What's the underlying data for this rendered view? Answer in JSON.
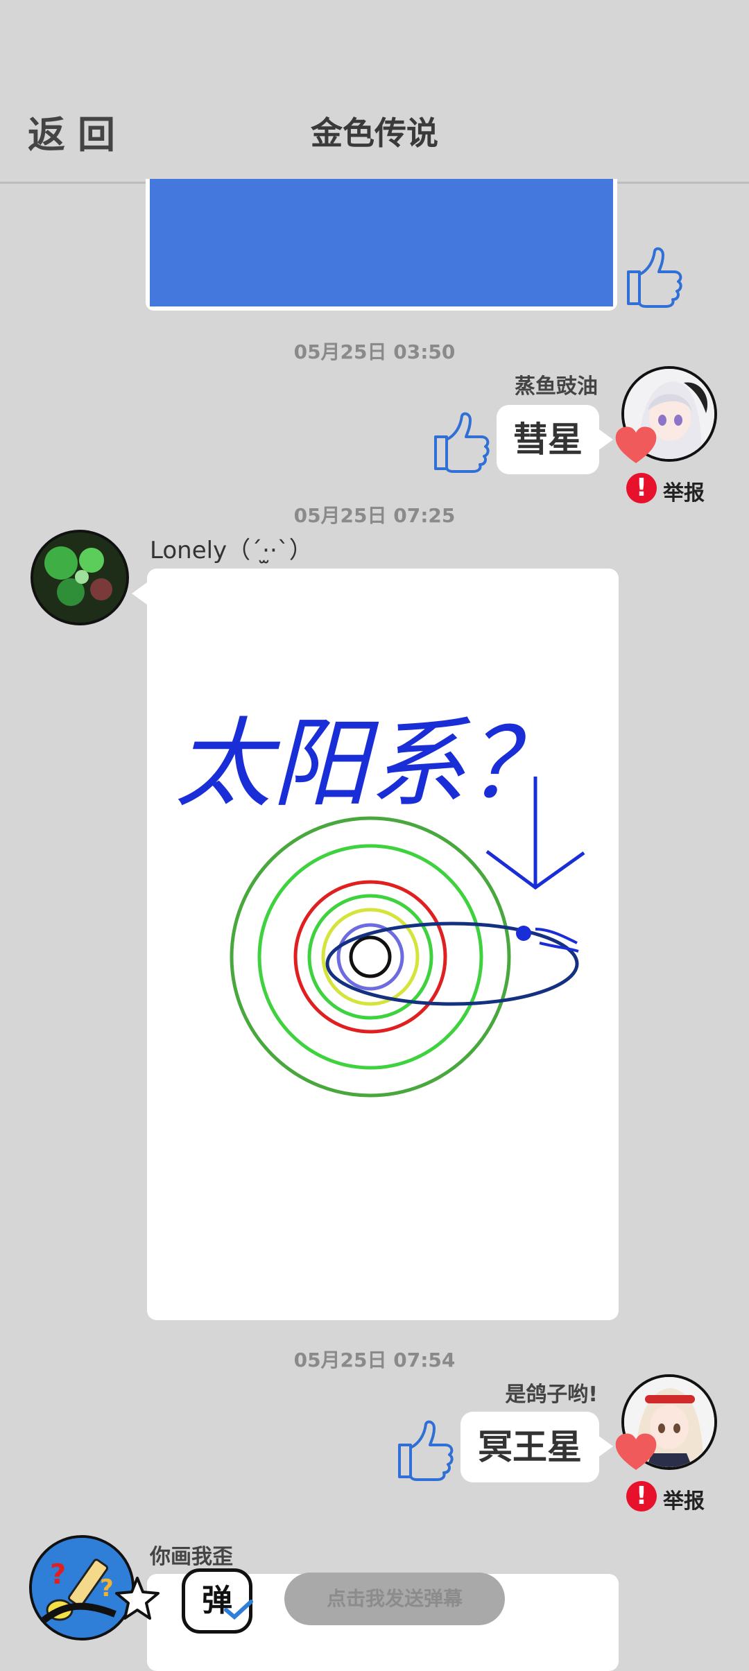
{
  "header": {
    "back_label": "返回",
    "title": "金色传说"
  },
  "messages": [
    {
      "timestamp": "05月25日  03:50",
      "user": "蒸鱼豉油",
      "text": "彗星",
      "report_label": "举报"
    },
    {
      "timestamp": "05月25日  07:25",
      "user": "Lonely（ˊ·̫·ˋ）",
      "drawing_text": "太阳系？"
    },
    {
      "timestamp": "05月25日  07:54",
      "user": "是鸽子哟!",
      "text": "冥王星",
      "report_label": "举报"
    },
    {
      "user": "你画我歪"
    }
  ],
  "bottom_bar": {
    "danmu_icon_label": "弹",
    "send_danmu_label": "点击我发送弹幕"
  },
  "colors": {
    "background": "#d6d6d6",
    "blue_block": "#4578dc",
    "like_blue": "#2f6fd6",
    "heart_red": "#f05a5a",
    "report_red": "#e8112c"
  },
  "icons": [
    "thumbs-up-icon",
    "heart-icon",
    "report-icon",
    "star-icon",
    "danmu-icon",
    "pencil-avatar"
  ]
}
